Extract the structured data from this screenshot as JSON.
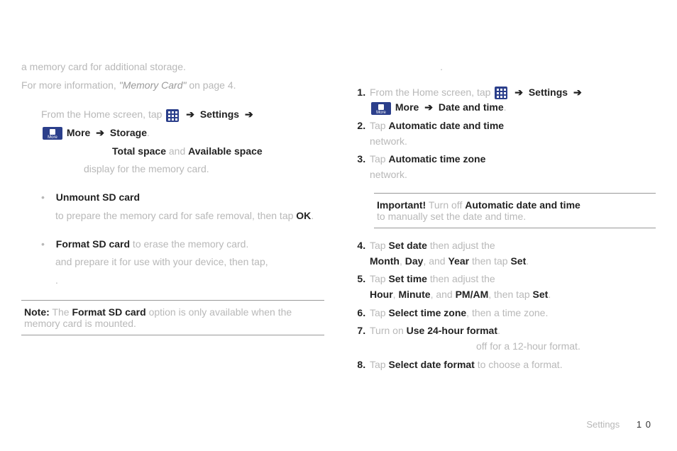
{
  "left": {
    "intro_line1_pre": "a memory card for additional storage",
    "intro_line1_post": ".",
    "memcard_pre": "For more information,",
    "memcard_ref": "\"Memory Card\"",
    "memcard_mid": " on page ",
    "memcard_page": "4",
    "memcard_post": ".",
    "path_pre": "From the Home screen,",
    "path_tap": " tap ",
    "path_settings": "Settings",
    "path_more": "More",
    "path_storage": "Storage",
    "total_space": "Total space",
    "avail_space": "Available space",
    "space_tail": "display for the memory card",
    "unmount": "Unmount SD card",
    "unmount_tail1": "to prepare the memory card for safe removal,",
    "unmount_tail2": " then tap ",
    "ok": "OK",
    "format": "Format SD card",
    "format_mid": " to erase the memory card",
    "format_tail": "and prepare it for use with your device, then tap,",
    "format_tail2": ".",
    "note_label": "Note:",
    "note_bold": "Format SD card",
    "note_tail": " option is only available when the memory card is mounted."
  },
  "right": {
    "intro_tail": ".",
    "s1_pre": "From the Home screen,",
    "settings": "Settings",
    "more": "More",
    "datetime": "Date and time",
    "s2_a": "Automatic date and time",
    "s2_b": "network",
    "s3_a": "Automatic time zone",
    "s3_b": "network",
    "imp_label": "Important!",
    "imp_bold": "Automatic date and time",
    "imp_tail": "to manually set the date and time",
    "s4_a": "Set date",
    "s4_month": "Month",
    "s4_day": "Day",
    "s4_year": "Year",
    "s4_set": "Set",
    "s5_a": "Set time",
    "s5_hour": "Hour",
    "s5_min": "Minute",
    "s5_ampm": "PM/AM",
    "s5_set": "Set",
    "s6_a": "Select time zone",
    "s6_tail": "then a time zone",
    "s7_a": "Use 24-hour format",
    "s7_tail_a": "off for a 12-",
    "s7_tail_b": "hour format",
    "s8_a": "Select date format",
    "s8_tail": "to choose a format",
    "footer_text": "Settings",
    "footer_page": "1 0"
  }
}
